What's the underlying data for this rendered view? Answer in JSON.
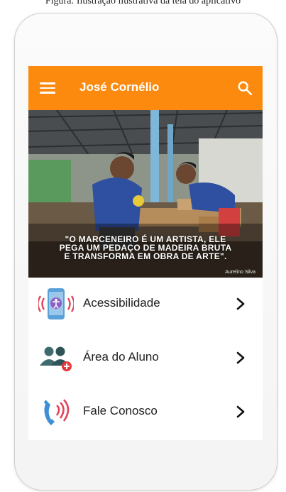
{
  "caption": "Figura: Ilustração ilustrativa da tela do aplicativo",
  "app": {
    "title": "José Cornélio",
    "accent_color": "#fb8a0e"
  },
  "hero": {
    "quote_lines": [
      "\"O MARCENEIRO É UM ARTISTA, ELE",
      "PEGA UM PEDAÇO DE MADEIRA BRUTA",
      "E TRANSFORMA EM OBRA DE ARTE\"."
    ],
    "author": "Aurelino Silva"
  },
  "menu": [
    {
      "label": "Acessibilidade",
      "icon": "accessibility-phone-icon"
    },
    {
      "label": "Área do Aluno",
      "icon": "student-group-icon"
    },
    {
      "label": "Fale Conosco",
      "icon": "phone-call-icon"
    }
  ],
  "icons": {
    "menu": "hamburger-menu-icon",
    "search": "search-icon",
    "chevron": "chevron-right-icon"
  }
}
